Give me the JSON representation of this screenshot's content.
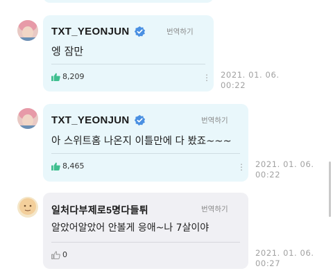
{
  "messages": [
    {
      "author": "TXT_YEONJUN",
      "translate_label": "번역하기",
      "text": "엥 잠만",
      "likes": "8,209",
      "date": "2021. 01. 06.",
      "time": "00:22"
    },
    {
      "author": "TXT_YEONJUN",
      "translate_label": "번역하기",
      "text": "아 스위트홈 나온지 이틀만에 다 봤죠~~~",
      "likes": "8,465",
      "date": "2021. 01. 06.",
      "time": "00:22"
    },
    {
      "author": "일처다부제로5명다들튀",
      "translate_label": "번역하기",
      "text": "알았어알았어 안볼게 응애~나 7살이야",
      "likes": "0",
      "date": "2021. 01. 06.",
      "time": "00:27"
    }
  ],
  "colors": {
    "artist_bubble": "#e9f7fb",
    "fan_bubble": "#f0f0f4",
    "like_active": "#3fbf8f",
    "verified_badge": "#4a90e2"
  },
  "icons": {
    "verified": "verified-badge-icon",
    "like_filled": "thumbs-up-filled-icon",
    "like_outline": "thumbs-up-outline-icon",
    "more": "more-vertical-icon"
  }
}
